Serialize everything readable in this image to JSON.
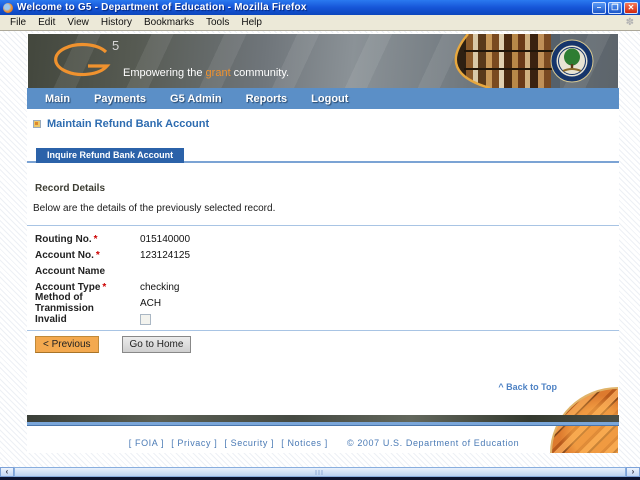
{
  "window": {
    "title": "Welcome to G5 - Department of Education - Mozilla Firefox",
    "controls": {
      "minimize": "–",
      "restore": "❐",
      "close": "✕"
    },
    "menu": [
      "File",
      "Edit",
      "View",
      "History",
      "Bookmarks",
      "Tools",
      "Help"
    ],
    "throbber_glyph": "✽"
  },
  "banner": {
    "logo_sup": "5",
    "tagline_prefix": "Empowering the ",
    "tagline_accent": "grant",
    "tagline_suffix": " community."
  },
  "nav": {
    "items": [
      "Main",
      "Payments",
      "G5 Admin",
      "Reports",
      "Logout"
    ]
  },
  "page": {
    "title": "Maintain Refund Bank Account",
    "tab": "Inquire Refund Bank Account",
    "section_heading": "Record Details",
    "section_description": "Below are the details of the previously selected record."
  },
  "fields": [
    {
      "label": "Routing No.",
      "star": "*",
      "value": "015140000"
    },
    {
      "label": "Account No.",
      "star": "*",
      "value": "123124125"
    },
    {
      "label": "Account Name",
      "star": "",
      "value": ""
    },
    {
      "label": "Account Type",
      "star": "*",
      "value": "checking"
    },
    {
      "label": "Method of Tranmission",
      "star": "",
      "value": "ACH"
    },
    {
      "label": "Invalid",
      "star": "",
      "value": "unchecked"
    }
  ],
  "buttons": {
    "previous": "< Previous",
    "home": "Go to Home"
  },
  "back_to_top": "^ Back to Top",
  "footer": {
    "links": [
      {
        "text": "[  FOIA  ]"
      },
      {
        "text": "[  Privacy  ]"
      },
      {
        "text": "[  Security  ]"
      },
      {
        "text": "[  Notices  ]"
      }
    ],
    "copyright": "©  2007  U.S.  Department  of  Education"
  },
  "scrollbar": {
    "left_arrow": "‹",
    "right_arrow": "›"
  },
  "colors": {
    "titlebar_blue": "#1655d8",
    "nav_blue": "#5b8fc7",
    "tab_blue": "#2b62a9",
    "accent_orange": "#f0922e",
    "title_link_blue": "#2e6cb0",
    "required_red": "#cc0000",
    "footer_link_blue": "#4a7ab5"
  }
}
